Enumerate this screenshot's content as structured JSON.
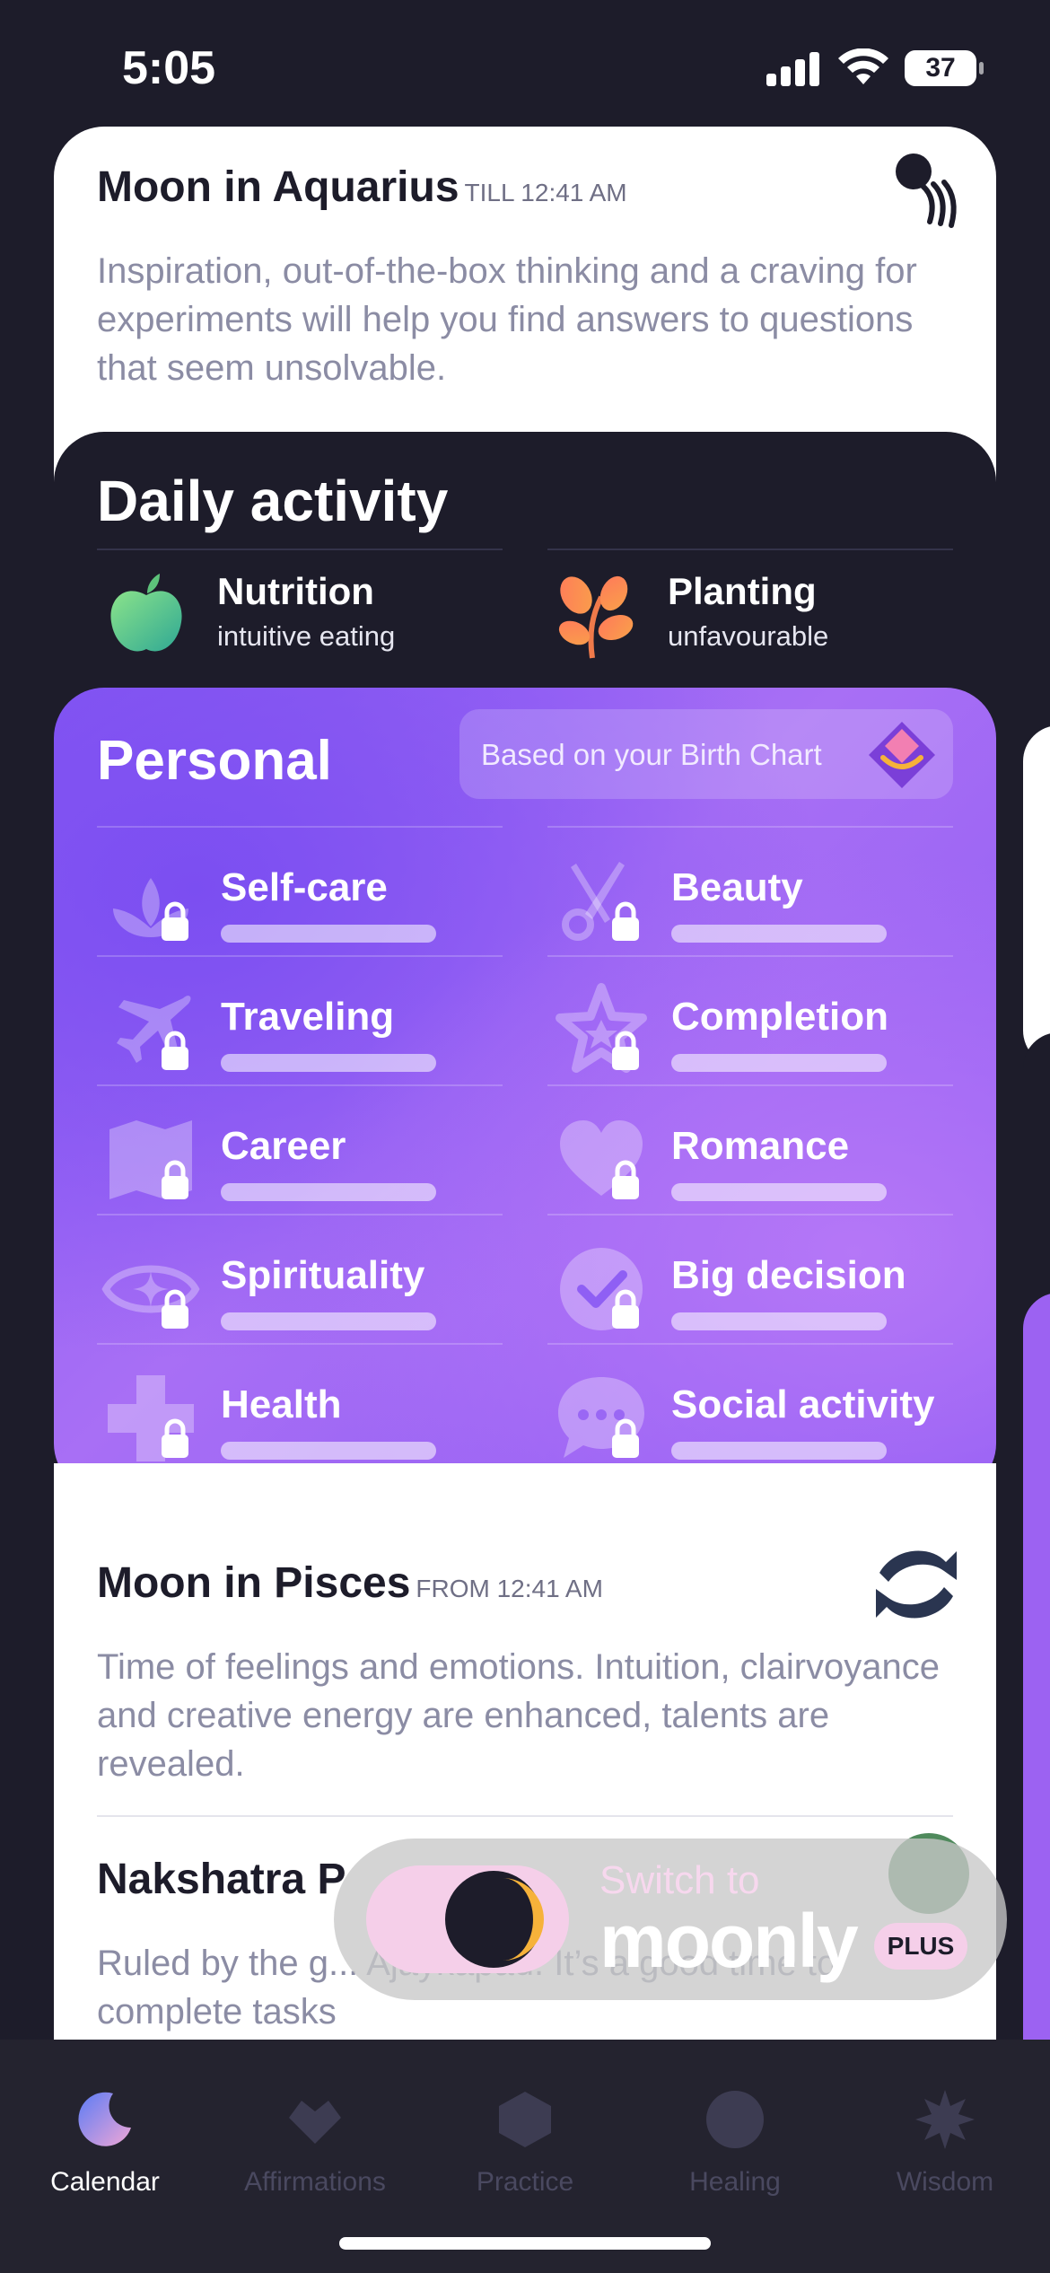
{
  "status_bar": {
    "time": "5:05",
    "battery": "37"
  },
  "moon_current": {
    "title": "Moon in Aquarius",
    "time": "TILL 12:41 AM",
    "description": "Inspiration, out-of-the-box thinking and a craving for experiments will help you find answers to questions that seem unsolvable.",
    "icon": "aquarius-icon"
  },
  "daily_activity": {
    "title": "Daily activity",
    "items": [
      {
        "title": "Nutrition",
        "subtitle": "intuitive eating",
        "icon": "apple-icon"
      },
      {
        "title": "Planting",
        "subtitle": "unfavourable",
        "icon": "plant-icon"
      }
    ]
  },
  "personal": {
    "title": "Personal",
    "badge": "Based on your Birth Chart",
    "items": [
      {
        "label": "Self-care",
        "icon": "lotus-icon",
        "locked": true
      },
      {
        "label": "Beauty",
        "icon": "scissors-icon",
        "locked": true
      },
      {
        "label": "Traveling",
        "icon": "airplane-icon",
        "locked": true
      },
      {
        "label": "Completion",
        "icon": "star-icon",
        "locked": true
      },
      {
        "label": "Career",
        "icon": "map-icon",
        "locked": true
      },
      {
        "label": "Romance",
        "icon": "heart-icon",
        "locked": true
      },
      {
        "label": "Spirituality",
        "icon": "eye-icon",
        "locked": true
      },
      {
        "label": "Big decision",
        "icon": "check-icon",
        "locked": true
      },
      {
        "label": "Health",
        "icon": "cross-icon",
        "locked": true
      },
      {
        "label": "Social activity",
        "icon": "chat-icon",
        "locked": true
      }
    ]
  },
  "moon_next": {
    "title": "Moon in Pisces",
    "time": "FROM 12:41 AM",
    "description": "Time of feelings and emotions. Intuition, clairvoyance and creative energy are enhanced, talents are revealed.",
    "icon": "pisces-icon"
  },
  "nakshatra": {
    "title": "Nakshatra P",
    "description": "Ruled by the g... Ajaykapad. It’s a good time to complete tasks"
  },
  "promo": {
    "switch_label": "Switch to",
    "brand": "moonly",
    "badge": "PLUS"
  },
  "tabs": [
    {
      "label": "Calendar",
      "icon": "moon-icon",
      "active": true
    },
    {
      "label": "Affirmations",
      "icon": "heart-icon",
      "active": false
    },
    {
      "label": "Practice",
      "icon": "hexagon-icon",
      "active": false
    },
    {
      "label": "Healing",
      "icon": "circle-icon",
      "active": false
    },
    {
      "label": "Wisdom",
      "icon": "sun-icon",
      "active": false
    }
  ],
  "colors": {
    "background": "#1d1c2a",
    "accent_purple": "#8f5ff4",
    "muted_text": "#8b8ca4",
    "promo_pink": "#f5cfe9"
  }
}
